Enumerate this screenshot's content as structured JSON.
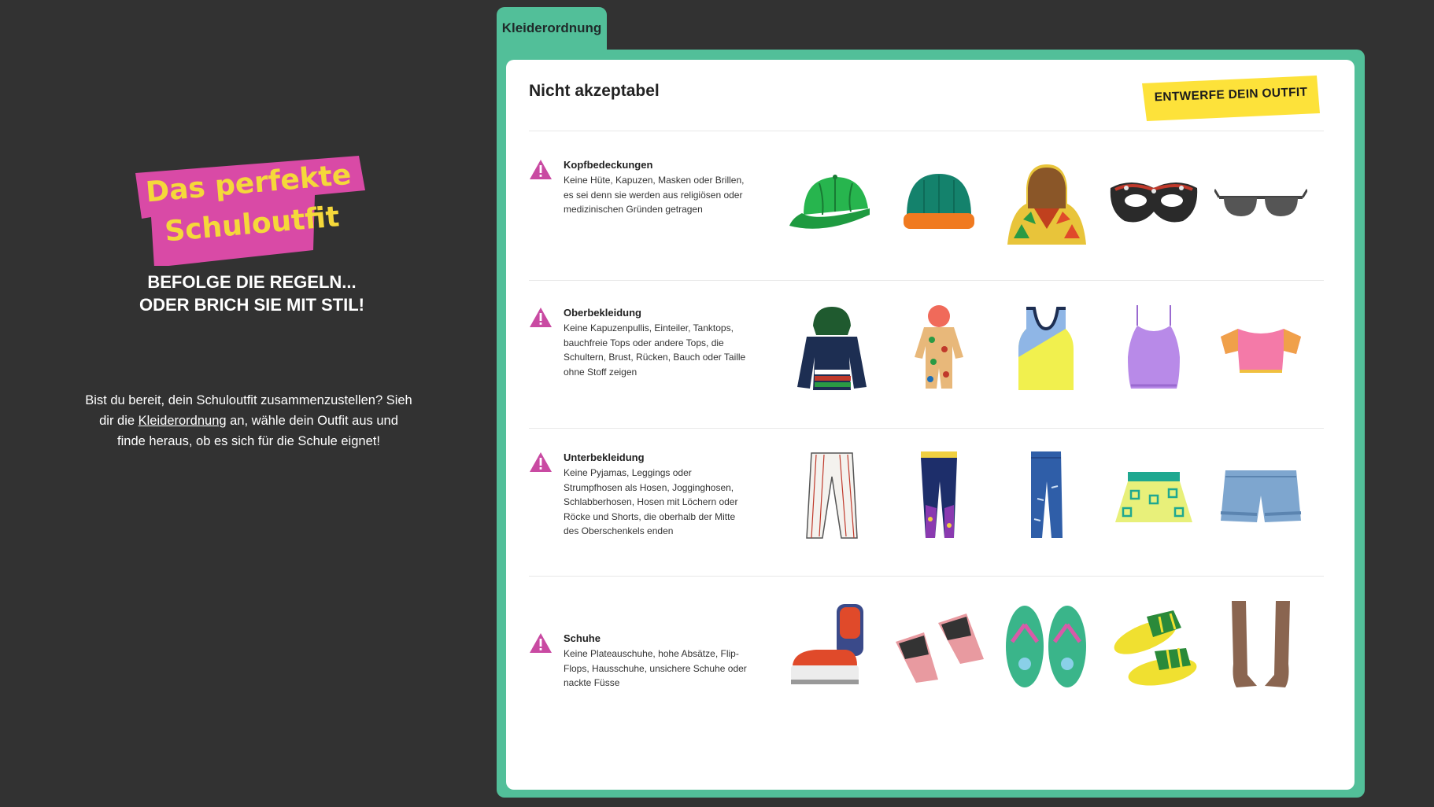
{
  "left": {
    "title_line1": "Das perfekte",
    "title_line2": "Schuloutfit",
    "subtitle_line1": "BEFOLGE DIE REGELN...",
    "subtitle_line2": "ODER BRICH SIE MIT STIL!",
    "intro_part1": "Bist du bereit, dein Schuloutfit zusammenzustellen? Sieh dir die ",
    "intro_link": "Kleiderordnung",
    "intro_part2": " an, wähle dein Outfit aus und finde heraus, ob es sich für die Schule eignet!"
  },
  "tab": {
    "label": "Kleiderordnung"
  },
  "card": {
    "title": "Nicht akzeptabel",
    "cta_label": "ENTWERFE DEIN OUTFIT"
  },
  "rules": [
    {
      "title": "Kopfbedeckungen",
      "text": "Keine Hüte, Kapuzen, Masken oder Brillen, es sei denn sie werden aus religiösen oder medizinischen Gründen getragen",
      "items": [
        "cap-icon",
        "beanie-icon",
        "hood-icon",
        "mask-icon",
        "sunglasses-icon"
      ]
    },
    {
      "title": "Oberbekleidung",
      "text": "Keine Kapuzenpullis, Einteiler, Tanktops, bauchfreie Tops oder andere Tops, die Schultern, Brust, Rücken, Bauch oder Taille ohne Stoff zeigen",
      "items": [
        "hoodie-icon",
        "onesie-icon",
        "tanktop-icon",
        "camisole-icon",
        "croptop-icon"
      ]
    },
    {
      "title": "Unterbekleidung",
      "text": "Keine Pyjamas, Leggings oder Strumpfhosen als Hosen, Jogginghosen, Schlabberhosen, Hosen mit Löchern oder Röcke und Shorts, die oberhalb der Mitte des Oberschenkels enden",
      "items": [
        "pyjama-pants-icon",
        "leggings-icon",
        "ripped-jeans-icon",
        "mini-skirt-icon",
        "denim-shorts-icon"
      ]
    },
    {
      "title": "Schuhe",
      "text": "Keine Plateauschuhe, hohe Absätze, Flip-Flops, Hausschuhe, unsichere Schuhe oder nackte Füsse",
      "items": [
        "platform-sneaker-icon",
        "heel-sandal-icon",
        "flip-flops-icon",
        "slippers-icon",
        "bare-feet-icon"
      ]
    }
  ],
  "colors": {
    "background": "#323232",
    "accent_green": "#52bf99",
    "title_pink": "#d94aa6",
    "title_yellow": "#f5d83a",
    "cta_yellow": "#fde23a",
    "warning_pink": "#c94aa2"
  }
}
